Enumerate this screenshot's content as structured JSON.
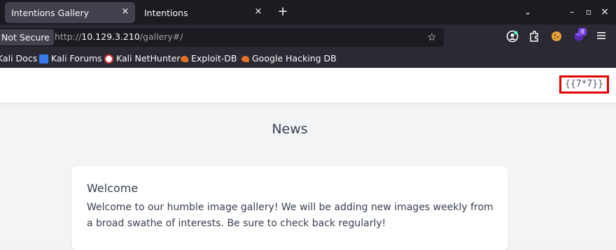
{
  "browser": {
    "tabs": [
      {
        "title": "Intentions Gallery",
        "active": true
      },
      {
        "title": "Intentions",
        "active": false
      }
    ],
    "new_tab_symbol": "+",
    "tab_close_symbol": "×",
    "window_controls": {
      "list": "⌄",
      "minimize": "–",
      "maximize": "▫",
      "close": "×"
    },
    "security_label": "Not Secure",
    "url": {
      "scheme": "http://",
      "host": "10.129.3.210",
      "path": "/gallery#/"
    },
    "extension_badge": "8",
    "bookmarks": [
      {
        "label": "Kali Docs",
        "icon": "kali-icon",
        "color": "#367bf0"
      },
      {
        "label": "Kali Forums",
        "icon": "kali-icon",
        "color": "#367bf0"
      },
      {
        "label": "Kali NetHunter",
        "icon": "nethunter-icon",
        "color": "#d83b3b"
      },
      {
        "label": "Exploit-DB",
        "icon": "exploitdb-icon",
        "color": "#e2702a"
      },
      {
        "label": "Google Hacking DB",
        "icon": "exploitdb-icon",
        "color": "#e2702a"
      }
    ]
  },
  "page": {
    "nav_probe_text": "{{7*7}}",
    "heading": "News",
    "news": [
      {
        "title": "Welcome",
        "body": "Welcome to our humble image gallery! We will be adding new images weekly from a broad swathe of interests. Be sure to check back regularly!"
      }
    ],
    "highlight_color": "#e00000"
  }
}
